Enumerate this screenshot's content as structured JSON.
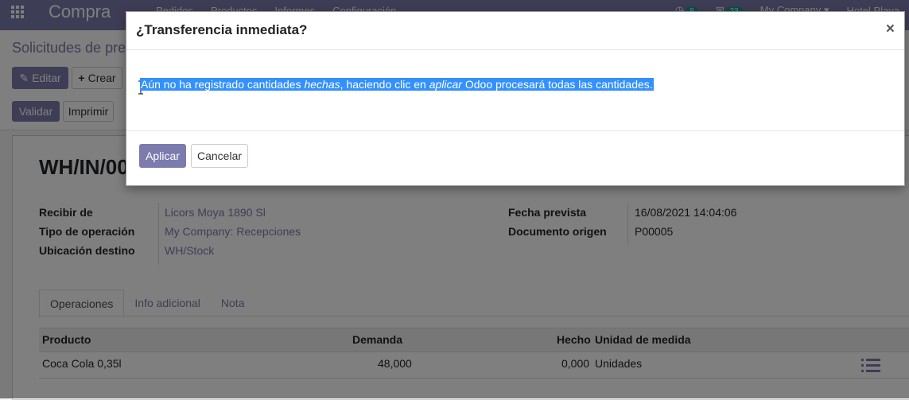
{
  "topbar": {
    "app_name": "Compra",
    "menu": [
      "Pedidos",
      "Productos",
      "Informes",
      "Configuración"
    ],
    "activity_count": "8",
    "messages_count": "23",
    "company": "My Company",
    "user": "Hotel Playa"
  },
  "control_panel": {
    "breadcrumb": "Solicitudes de pre",
    "edit_label": "Editar",
    "create_label": "Crear",
    "validate_label": "Validar",
    "print_label": "Imprimir"
  },
  "form": {
    "reference": "WH/IN/00",
    "left_fields": [
      {
        "label": "Recibir de",
        "value": "Licors Moya 1890 Sl"
      },
      {
        "label": "Tipo de operación",
        "value": "My Company: Recepciones"
      },
      {
        "label": "Ubicación destino",
        "value": "WH/Stock"
      }
    ],
    "right_fields": [
      {
        "label": "Fecha prevista",
        "value": "16/08/2021 14:04:06"
      },
      {
        "label": "Documento origen",
        "value": "P00005"
      }
    ],
    "tabs": [
      "Operaciones",
      "Info adicional",
      "Nota"
    ]
  },
  "table": {
    "headers": {
      "product": "Producto",
      "demand": "Demanda",
      "done": "Hecho",
      "uom": "Unidad de medida"
    },
    "rows": [
      {
        "product": "Coca Cola 0,35l",
        "demand": "48,000",
        "done": "0,000",
        "uom": "Unidades"
      }
    ]
  },
  "modal": {
    "title": "¿Transferencia inmediata?",
    "close_glyph": "×",
    "body_part1": "Aún no ha registrado cantidades ",
    "body_em1": "hechas",
    "body_part2": ", haciendo clic en ",
    "body_em2": "aplicar",
    "body_part3": " Odoo procesará todas las cantidades.",
    "apply_label": "Aplicar",
    "cancel_label": "Cancelar"
  },
  "colors": {
    "brand": "#7c7bad",
    "selection": "#3390ff",
    "badge": "#00a09d"
  }
}
